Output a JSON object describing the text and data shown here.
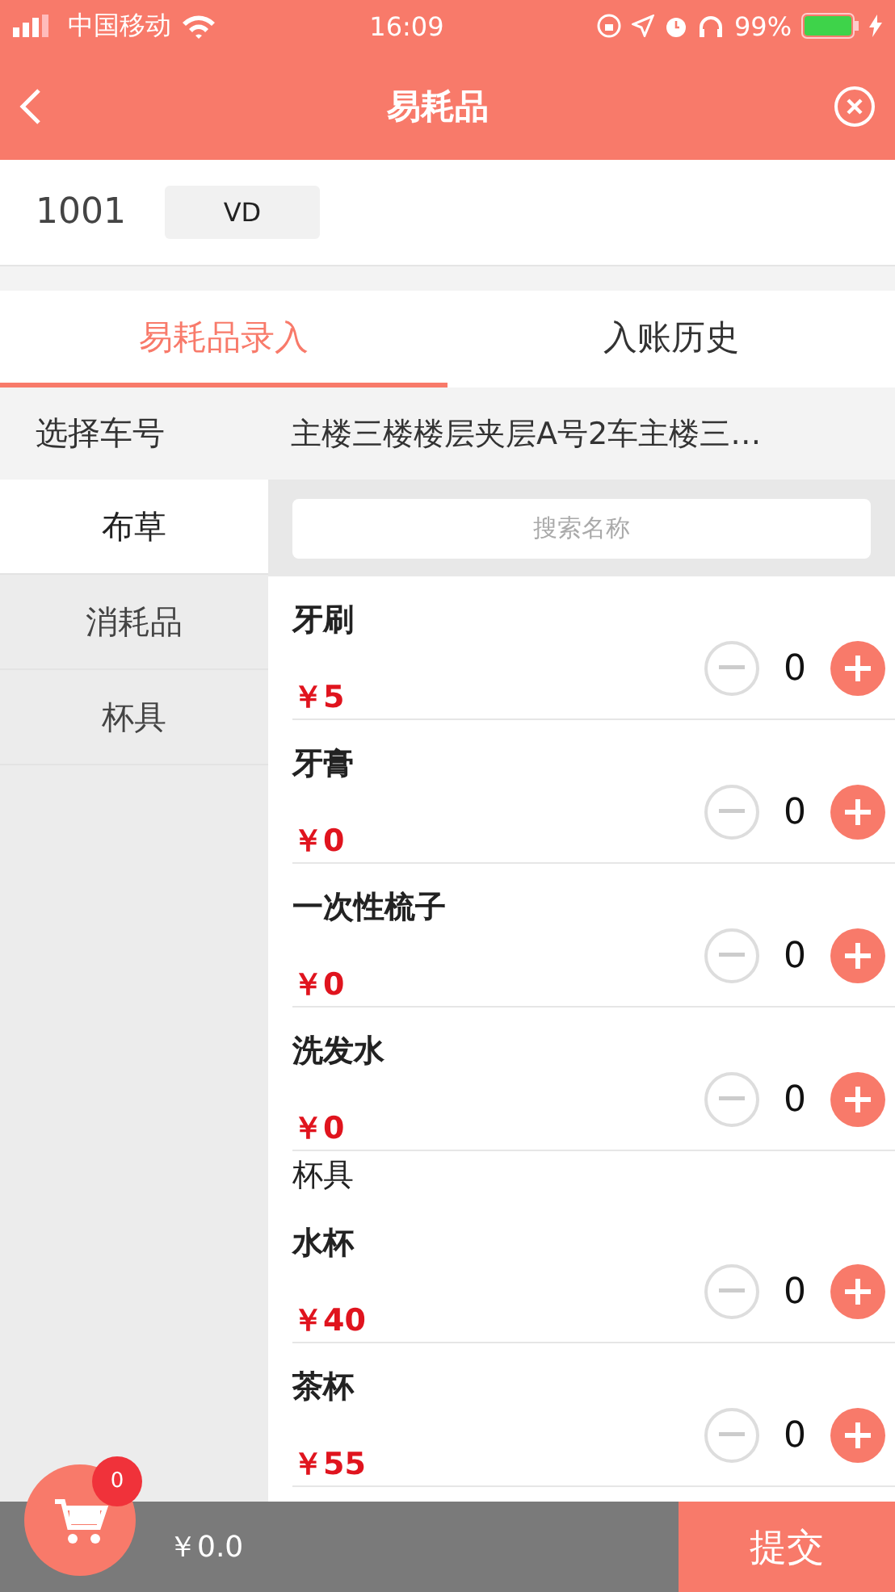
{
  "status_bar": {
    "carrier": "中国移动",
    "time": "16:09",
    "battery": "99%"
  },
  "header": {
    "title": "易耗品"
  },
  "info": {
    "room": "1001",
    "tag": "VD"
  },
  "tabs": [
    {
      "label": "易耗品录入",
      "selected": true
    },
    {
      "label": "入账历史",
      "selected": false
    }
  ],
  "car_select": {
    "label": "选择车号",
    "value": "主楼三楼楼层夹层A号2车主楼三…"
  },
  "sidebar": [
    {
      "label": "布草",
      "selected": true
    },
    {
      "label": "消耗品",
      "selected": false
    },
    {
      "label": "杯具",
      "selected": false
    }
  ],
  "search": {
    "placeholder": "搜索名称"
  },
  "list": [
    {
      "kind": "item",
      "name": "牙刷",
      "price": "￥5",
      "quantity": "0"
    },
    {
      "kind": "item",
      "name": "牙膏",
      "price": "￥0",
      "quantity": "0"
    },
    {
      "kind": "item",
      "name": "一次性梳子",
      "price": "￥0",
      "quantity": "0"
    },
    {
      "kind": "item",
      "name": "洗发水",
      "price": "￥0",
      "quantity": "0"
    },
    {
      "kind": "header",
      "name": "杯具"
    },
    {
      "kind": "item",
      "name": "水杯",
      "price": "￥40",
      "quantity": "0"
    },
    {
      "kind": "item",
      "name": "茶杯",
      "price": "￥55",
      "quantity": "0"
    }
  ],
  "cart": {
    "count": "0",
    "total": "￥0.0",
    "submit": "提交"
  }
}
